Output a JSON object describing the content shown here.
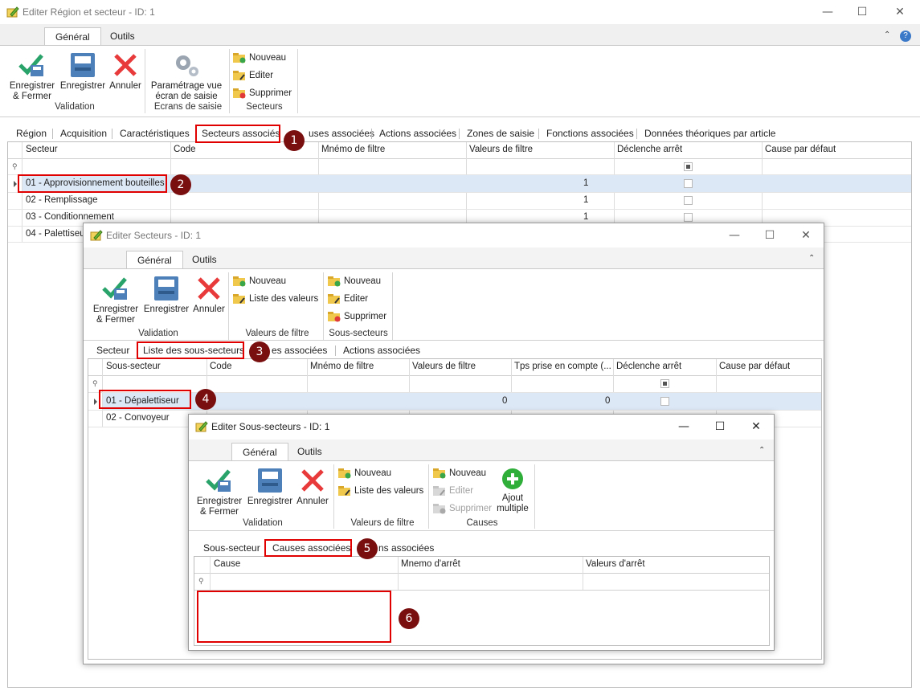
{
  "win1": {
    "title": "Editer Région et secteur - ID: 1",
    "controls": {
      "minimize": "—",
      "maximize": "☐",
      "close": "✕"
    },
    "tabs": [
      "Général",
      "Outils"
    ],
    "help": "?",
    "ribbon": {
      "save_close": "Enregistrer\n& Fermer",
      "save": "Enregistrer",
      "cancel": "Annuler",
      "settings": "Paramétrage vue\nécran de saisie",
      "new": "Nouveau",
      "edit": "Editer",
      "delete": "Supprimer",
      "groups": {
        "validation": "Validation",
        "ecrans": "Ecrans de saisie",
        "secteurs": "Secteurs"
      }
    },
    "inner_tabs": [
      "Région",
      "Acquisition",
      "Caractéristiques",
      "Secteurs associés",
      "uses associées",
      "Actions associées",
      "Zones de saisie",
      "Fonctions associées",
      "Données théoriques par article"
    ],
    "grid": {
      "columns": [
        "Secteur",
        "Code",
        "Mnémo de filtre",
        "Valeurs de filtre",
        "Déclenche arrêt",
        "Cause par défaut"
      ],
      "rows": [
        {
          "secteur": "01 - Approvisionnement bouteilles",
          "valeur": "1"
        },
        {
          "secteur": "02 - Remplissage",
          "valeur": "1"
        },
        {
          "secteur": "03 - Conditionnement",
          "valeur": "1"
        },
        {
          "secteur": "04 - Palettiseur",
          "valeur": ""
        }
      ]
    }
  },
  "win2": {
    "title": "Editer Secteurs - ID: 1",
    "tabs": [
      "Général",
      "Outils"
    ],
    "ribbon": {
      "save_close": "Enregistrer\n& Fermer",
      "save": "Enregistrer",
      "cancel": "Annuler",
      "new_filter": "Nouveau",
      "list_values": "Liste des valeurs",
      "new_sub": "Nouveau",
      "edit_sub": "Editer",
      "delete_sub": "Supprimer",
      "groups": {
        "validation": "Validation",
        "filtre": "Valeurs de filtre",
        "sous": "Sous-secteurs"
      }
    },
    "inner_tabs": [
      "Secteur",
      "Liste des sous-secteurs",
      "es associées",
      "Actions associées"
    ],
    "grid": {
      "columns": [
        "Sous-secteur",
        "Code",
        "Mnémo de filtre",
        "Valeurs de filtre",
        "Tps prise en compte (...",
        "Déclenche arrêt",
        "Cause par défaut"
      ],
      "rows": [
        {
          "sous": "01 - Dépalettiseur",
          "valeur": "0",
          "tps": "0"
        },
        {
          "sous": "02 - Convoyeur",
          "valeur": "",
          "tps": ""
        }
      ]
    }
  },
  "win3": {
    "title": "Editer Sous-secteurs - ID: 1",
    "tabs": [
      "Général",
      "Outils"
    ],
    "ribbon": {
      "save_close": "Enregistrer\n& Fermer",
      "save": "Enregistrer",
      "cancel": "Annuler",
      "new_filter": "Nouveau",
      "list_values": "Liste des valeurs",
      "new_cause": "Nouveau",
      "edit_cause": "Editer",
      "delete_cause": "Supprimer",
      "multi_add": "Ajout\nmultiple",
      "groups": {
        "validation": "Validation",
        "filtre": "Valeurs de filtre",
        "causes": "Causes"
      }
    },
    "inner_tabs": [
      "Sous-secteur",
      "Causes associées",
      "ns associées"
    ],
    "grid": {
      "columns": [
        "Cause",
        "Mnemo d'arrêt",
        "Valeurs d'arrêt"
      ]
    }
  },
  "annotations": [
    "1",
    "2",
    "3",
    "4",
    "5",
    "6"
  ],
  "colors": {
    "accent_red": "#e00000",
    "badge": "#7a0f0f",
    "selection": "#dde8f6"
  }
}
